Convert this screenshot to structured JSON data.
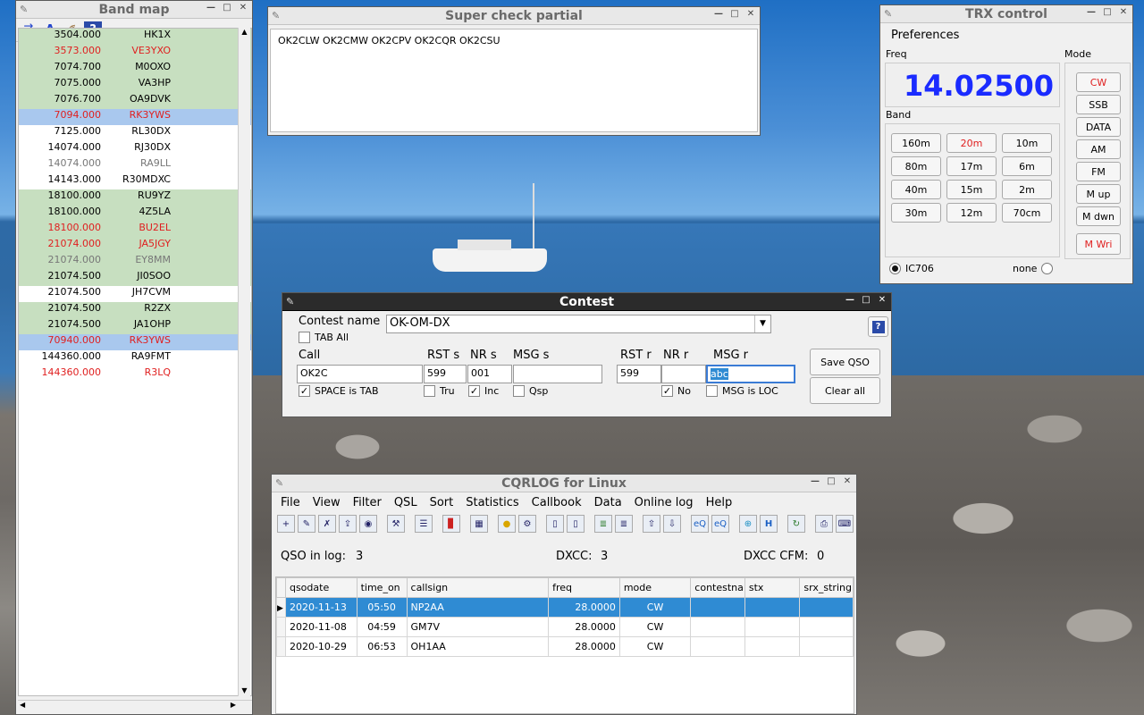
{
  "band_map": {
    "title": "Band map",
    "rows": [
      {
        "freq": "3504.000",
        "call": "HK1X",
        "style": "green",
        "color": "black"
      },
      {
        "freq": "3573.000",
        "call": "VE3YXO",
        "style": "green",
        "color": "red"
      },
      {
        "freq": "7074.700",
        "call": "M0OXO",
        "style": "green",
        "color": "black"
      },
      {
        "freq": "7075.000",
        "call": "VA3HP",
        "style": "green",
        "color": "black"
      },
      {
        "freq": "7076.700",
        "call": "OA9DVK",
        "style": "green",
        "color": "black"
      },
      {
        "freq": "7094.000",
        "call": "RK3YWS",
        "style": "blue",
        "color": "red"
      },
      {
        "freq": "7125.000",
        "call": "RL30DX",
        "style": "none",
        "color": "black"
      },
      {
        "freq": "14074.000",
        "call": "RJ30DX",
        "style": "none",
        "color": "black"
      },
      {
        "freq": "14074.000",
        "call": "RA9LL",
        "style": "none",
        "color": "gray"
      },
      {
        "freq": "14143.000",
        "call": "R30MDXC",
        "style": "none",
        "color": "black"
      },
      {
        "freq": "18100.000",
        "call": "RU9YZ",
        "style": "green",
        "color": "black"
      },
      {
        "freq": "18100.000",
        "call": "4Z5LA",
        "style": "green",
        "color": "black"
      },
      {
        "freq": "18100.000",
        "call": "BU2EL",
        "style": "green",
        "color": "red"
      },
      {
        "freq": "21074.000",
        "call": "JA5JGY",
        "style": "green",
        "color": "red"
      },
      {
        "freq": "21074.000",
        "call": "EY8MM",
        "style": "green",
        "color": "gray"
      },
      {
        "freq": "21074.500",
        "call": "JI0SOO",
        "style": "green",
        "color": "black"
      },
      {
        "freq": "21074.500",
        "call": "JH7CVM",
        "style": "none",
        "color": "black"
      },
      {
        "freq": "21074.500",
        "call": "R2ZX",
        "style": "green",
        "color": "black"
      },
      {
        "freq": "21074.500",
        "call": "JA1OHP",
        "style": "green",
        "color": "black"
      },
      {
        "freq": "70940.000",
        "call": "RK3YWS",
        "style": "blue",
        "color": "red"
      },
      {
        "freq": "144360.000",
        "call": "RA9FMT",
        "style": "none",
        "color": "black"
      },
      {
        "freq": "144360.000",
        "call": "R3LQ",
        "style": "none",
        "color": "red"
      }
    ]
  },
  "scp": {
    "title": "Super check partial",
    "text": "OK2CLW OK2CMW OK2CPV OK2CQR OK2CSU"
  },
  "trx": {
    "title": "TRX control",
    "preferences": "Preferences",
    "freq_label": "Freq",
    "freq": "14.02500",
    "band_label": "Band",
    "mode_label": "Mode",
    "bands": [
      "160m",
      "20m",
      "10m",
      "80m",
      "17m",
      "6m",
      "40m",
      "15m",
      "2m",
      "30m",
      "12m",
      "70cm"
    ],
    "active_band": "20m",
    "modes": [
      "CW",
      "SSB",
      "DATA",
      "AM",
      "FM",
      "M up",
      "M dwn"
    ],
    "active_mode": "CW",
    "mwri": "M Wri",
    "radio1": "IC706",
    "radio2": "none"
  },
  "contest": {
    "title": "Contest",
    "contest_name_label": "Contest name",
    "contest_name": "OK-OM-DX",
    "tab_all": "TAB All",
    "call_label": "Call",
    "rst_s_label": "RST s",
    "nr_s_label": "NR s",
    "msg_s_label": "MSG s",
    "rst_r_label": "RST r",
    "nr_r_label": "NR r",
    "msg_r_label": "MSG r",
    "call": "OK2C",
    "rst_s": "599",
    "nr_s": "001",
    "msg_s": "",
    "rst_r": "599",
    "nr_r": "",
    "msg_r": "abc",
    "space_is_tab": "SPACE is TAB",
    "tru": "Tru",
    "inc": "Inc",
    "qsp": "Qsp",
    "no": "No",
    "msg_is_loc": "MSG is LOC",
    "save": "Save QSO",
    "clear": "Clear all"
  },
  "main": {
    "title": "CQRLOG for Linux",
    "menu": [
      "File",
      "View",
      "Filter",
      "QSL",
      "Sort",
      "Statistics",
      "Callbook",
      "Data",
      "Online log",
      "Help"
    ],
    "qso_in_log_label": "QSO in log:",
    "qso_in_log": "3",
    "dxcc_label": "DXCC:",
    "dxcc": "3",
    "dxcc_cfm_label": "DXCC CFM:",
    "dxcc_cfm": "0",
    "columns": [
      "qsodate",
      "time_on",
      "callsign",
      "freq",
      "mode",
      "contestna",
      "stx",
      "srx_string"
    ],
    "rows": [
      [
        "2020-11-13",
        "05:50",
        "NP2AA",
        "28.0000",
        "CW",
        "",
        "",
        ""
      ],
      [
        "2020-11-08",
        "04:59",
        "GM7V",
        "28.0000",
        "CW",
        "",
        "",
        ""
      ],
      [
        "2020-10-29",
        "06:53",
        "OH1AA",
        "28.0000",
        "CW",
        "",
        "",
        ""
      ]
    ]
  }
}
